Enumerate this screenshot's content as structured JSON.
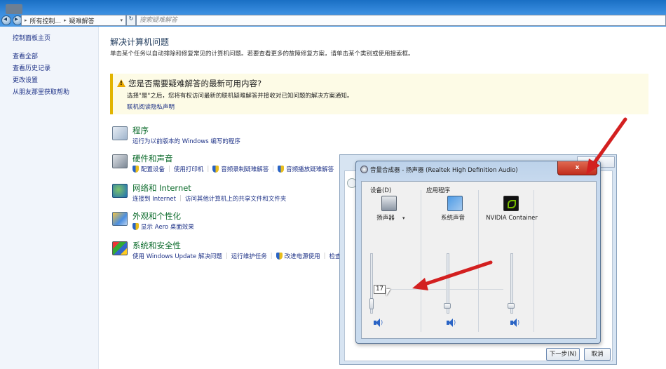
{
  "address": {
    "crumbs": [
      "所有控制...",
      "疑难解答"
    ],
    "search_placeholder": "搜索疑难解答"
  },
  "sidebar": {
    "items": [
      {
        "label": "控制面板主页"
      },
      {
        "label": "查看全部"
      },
      {
        "label": "查看历史记录"
      },
      {
        "label": "更改设置"
      },
      {
        "label": "从朋友那里获取帮助"
      }
    ]
  },
  "main": {
    "title": "解决计算机问题",
    "subtitle": "单击某个任务以自动排除和修复常见的计算机问题。若要查看更多的故障修复方案，请单击某个类别或使用搜索框。",
    "notice": {
      "title": "您是否需要疑难解答的最新可用内容?",
      "desc": "选择\"是\"之后，您将有权访问最新的联机疑难解答并接收对已知问题的解决方案通知。",
      "link": "联机阅读隐私声明"
    },
    "categories": [
      {
        "name": "程序",
        "links": [
          "运行为以前版本的 Windows 编写的程序"
        ]
      },
      {
        "name": "硬件和声音",
        "links": [
          "配置设备",
          "使用打印机",
          "音频录制疑难解答",
          "音频播放疑难解答"
        ]
      },
      {
        "name": "网络和 Internet",
        "links": [
          "连接到 Internet",
          "访问其他计算机上的共享文件和文件夹"
        ]
      },
      {
        "name": "外观和个性化",
        "links": [
          "显示 Aero 桌面效果"
        ]
      },
      {
        "name": "系统和安全性",
        "links": [
          "使用 Windows Update 解决问题",
          "运行维护任务",
          "改进电源使用",
          "检查"
        ]
      }
    ]
  },
  "mixer": {
    "title": "音量合成器 - 扬声器 (Realtek High Definition Audio)",
    "close_label": "x",
    "device_group": "设备(D)",
    "apps_group": "应用程序",
    "channels": [
      {
        "label": "扬声器",
        "level": 0.17
      },
      {
        "label": "系统声音",
        "level": 0.17
      },
      {
        "label": "NVIDIA Container",
        "level": 0.17
      }
    ],
    "tooltip_value": "17"
  },
  "dialog": {
    "next_label": "下一步(N)",
    "cancel_label": "取消"
  },
  "colors": {
    "accent_red": "#d32020",
    "link_blue": "#1e3287",
    "category_green": "#0a6a2a"
  }
}
